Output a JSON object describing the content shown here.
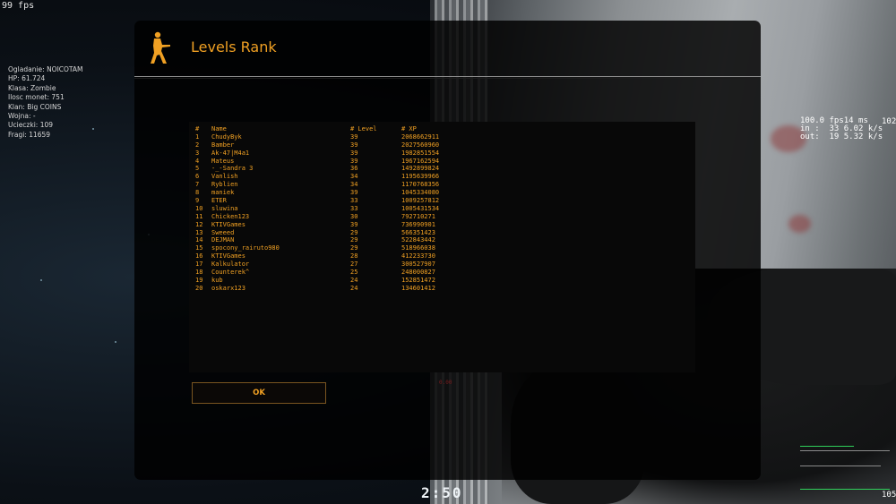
{
  "hud": {
    "fps": "99 fps",
    "info_lines": [
      "Ogladanie: NOICOTAM",
      "HP: 61.724",
      "Klasa: Zombie",
      "Ilosc monet: 751",
      "Klan: Big COINS",
      "Wojna: -",
      "Ucieczki: 109",
      "Fragi: 11659"
    ],
    "net_lines": [
      "100.0 fps14 ms",
      "in :  33 6.02 k/s",
      "out:  19 5.32 k/s"
    ],
    "net_right_top": "102",
    "net_right_bottom": "105",
    "round_time": "2:50"
  },
  "motd": {
    "title": "Levels Rank",
    "logo_icon": "counter-terrorist-logo-icon",
    "columns": [
      "#",
      "Name",
      "# Level",
      "# XP"
    ],
    "rows": [
      [
        "1",
        "ChudyByk",
        "39",
        "2068662911"
      ],
      [
        "2",
        "Bamber",
        "39",
        "2027560960"
      ],
      [
        "3",
        "Ak-47|M4a1",
        "39",
        "1982851554"
      ],
      [
        "4",
        "Mateus",
        "39",
        "1967162594"
      ],
      [
        "5",
        "-_-Sandra 3",
        "36",
        "1492899824"
      ],
      [
        "6",
        "Vanlish",
        "34",
        "1195639966"
      ],
      [
        "7",
        "Ryblien",
        "34",
        "1170768356"
      ],
      [
        "8",
        "maniek",
        "39",
        "1045334080"
      ],
      [
        "9",
        "ETER",
        "33",
        "1009257812"
      ],
      [
        "10",
        "sluwina",
        "33",
        "1005431534"
      ],
      [
        "11",
        "Chicken123",
        "30",
        "792710271"
      ],
      [
        "12",
        "KTIVGames",
        "39",
        "736990901"
      ],
      [
        "13",
        "Sweeed",
        "29",
        "566351423"
      ],
      [
        "14",
        "DEJMAN",
        "29",
        "522843442"
      ],
      [
        "15",
        "spocony_rairuto980",
        "29",
        "518966038"
      ],
      [
        "16",
        "KTIVGames",
        "28",
        "412233730"
      ],
      [
        "17",
        "Kalkulator",
        "27",
        "300527907"
      ],
      [
        "18",
        "Counterek^",
        "25",
        "248000827"
      ],
      [
        "19",
        "kub",
        "24",
        "152851472"
      ],
      [
        "20",
        "oskarx123",
        "24",
        "134601412"
      ]
    ],
    "ok_label": "OK",
    "faint_text": "0.00"
  },
  "colors": {
    "accent": "#f0a023",
    "panel_bg": "#000000"
  }
}
